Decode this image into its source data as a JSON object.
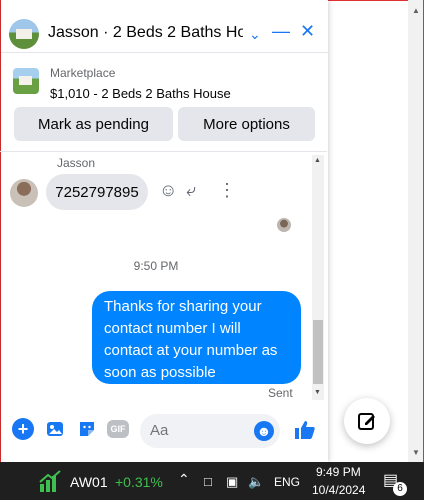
{
  "header": {
    "title": "Jasson · 2 Beds 2 Baths Ho...",
    "icons": [
      "chevron-down-icon",
      "minimize-icon",
      "close-icon"
    ]
  },
  "listing": {
    "label": "Marketplace",
    "price_title": "$1,010 - 2 Beds 2 Baths House",
    "buttons": {
      "pending": "Mark as pending",
      "more": "More options"
    }
  },
  "conversation": {
    "sender_name": "Jasson",
    "incoming_message": "7252797895",
    "timestamp": "9:50 PM",
    "outgoing_message": "Thanks for sharing your contact number I will contact at your number as soon as possible",
    "outgoing_lines": [
      "Thanks for sharing your",
      "contact number I will",
      "contact at your number as",
      "soon as possible"
    ],
    "status": "Sent"
  },
  "composer": {
    "placeholder": "Aa"
  },
  "taskbar": {
    "stock_symbol": "AW01",
    "stock_change": "+0.31%",
    "language": "ENG",
    "time": "9:49 PM",
    "date": "10/4/2024",
    "notification_count": "6"
  },
  "colors": {
    "messenger_blue": "#0084ff",
    "accent": "#1877f2",
    "stock_green": "#3fbf4f"
  }
}
